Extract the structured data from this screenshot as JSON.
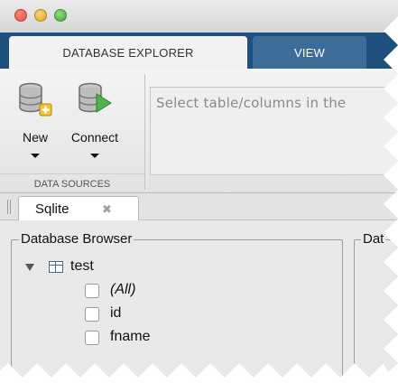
{
  "toolstrip": {
    "tabs": [
      {
        "label": "DATABASE EXPLORER",
        "active": true
      },
      {
        "label": "VIEW",
        "active": false
      }
    ]
  },
  "ribbon": {
    "buttons": [
      {
        "label": "New",
        "icon": "database-add-icon"
      },
      {
        "label": "Connect",
        "icon": "database-connect-icon"
      }
    ],
    "section_label": "DATA SOURCES",
    "sql_placeholder": "Select table/columns in the"
  },
  "document_tab": {
    "label": "Sqlite",
    "close_glyph": "✖"
  },
  "browser": {
    "title": "Database Browser",
    "tree": {
      "root": "test",
      "columns": [
        "(All)",
        "id",
        "fname"
      ]
    }
  },
  "right_panel": {
    "title": "Dat"
  },
  "colors": {
    "tab_bar": "#1f4f7c",
    "inactive_tab": "#3d6c99",
    "window_bg": "#e9e9e9"
  }
}
